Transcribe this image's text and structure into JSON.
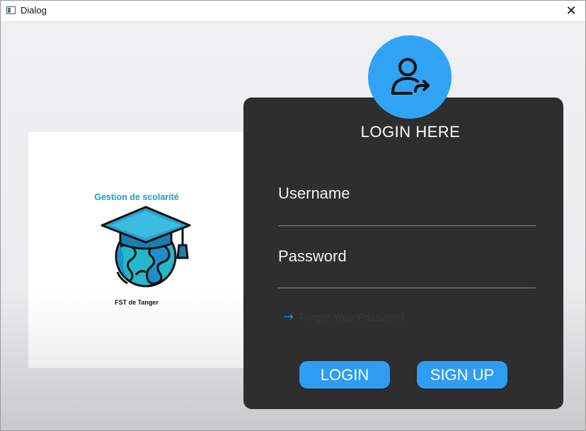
{
  "window": {
    "title": "Dialog",
    "close_glyph": "✕",
    "app_icon": "window-icon"
  },
  "logo": {
    "title": "Gestion de scolarité",
    "subtitle": "FST de Tanger",
    "icon": "graduation-globe-icon"
  },
  "login": {
    "avatar_icon": "user-login-icon",
    "heading": "LOGIN HERE",
    "username_label": "Username",
    "password_label": "Password",
    "forgot_arrow": "→",
    "forgot_text": "Forgot Your Password",
    "login_button": "LOGIN",
    "signup_button": "SIGN UP"
  },
  "colors": {
    "panel_bg": "#2e2e2e",
    "accent": "#2f9df1",
    "avatar_bg": "#31a3f5",
    "logo_title": "#1fa0c0"
  }
}
